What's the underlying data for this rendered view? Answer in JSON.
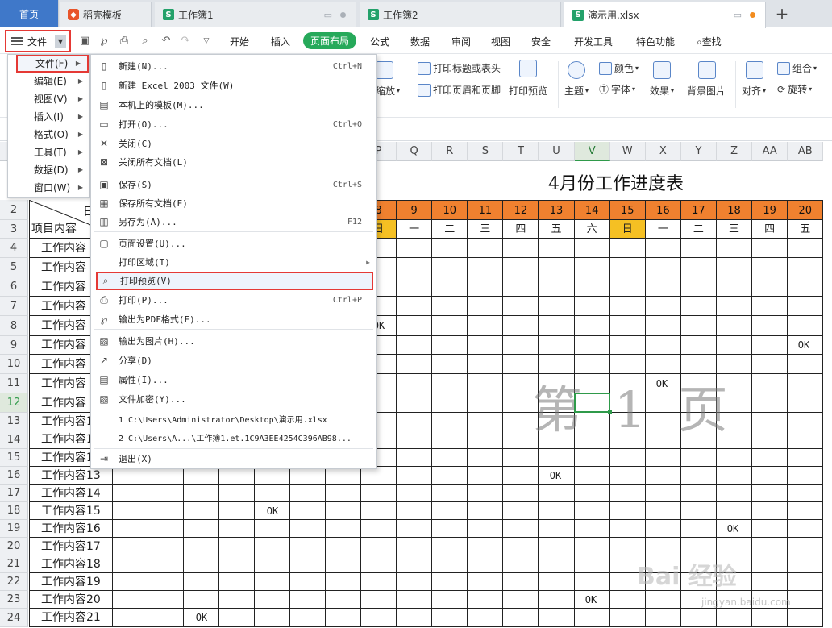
{
  "tabs": {
    "home": "首页",
    "template": "稻壳模板",
    "book1": "工作簿1",
    "book2": "工作簿2",
    "active": "演示用.xlsx",
    "new_tab": "+"
  },
  "menubar": {
    "file": "文件",
    "tabs": [
      "开始",
      "插入",
      "页面布局",
      "公式",
      "数据",
      "审阅",
      "视图",
      "安全",
      "开发工具",
      "特色功能"
    ],
    "active_tab": "页面布局",
    "search": "查找"
  },
  "ribbon": {
    "print_title": "打印标题或表头",
    "print_header_footer": "打印页眉和页脚",
    "print_preview": "打印预览",
    "scale": "缩放",
    "theme": "主题",
    "color": "颜色",
    "font": "字体",
    "effect": "效果",
    "background": "背景图片",
    "align": "对齐",
    "group": "组合",
    "rotate": "旋转"
  },
  "left_menu": {
    "items": [
      {
        "label": "文件(F)"
      },
      {
        "label": "编辑(E)"
      },
      {
        "label": "视图(V)"
      },
      {
        "label": "插入(I)"
      },
      {
        "label": "格式(O)"
      },
      {
        "label": "工具(T)"
      },
      {
        "label": "数据(D)"
      },
      {
        "label": "窗口(W)"
      }
    ],
    "selected": "文件(F)"
  },
  "file_menu": {
    "items": [
      {
        "label": "新建(N)...",
        "shortcut": "Ctrl+N",
        "icon": "new-doc-icon"
      },
      {
        "label": "新建 Excel 2003 文件(W)",
        "shortcut": "",
        "icon": "new-doc-icon"
      },
      {
        "label": "本机上的模板(M)...",
        "shortcut": "",
        "icon": "template-icon"
      },
      {
        "label": "打开(O)...",
        "shortcut": "Ctrl+O",
        "icon": "folder-icon"
      },
      {
        "label": "关闭(C)",
        "shortcut": "",
        "icon": "close-doc-icon"
      },
      {
        "label": "关闭所有文档(L)",
        "shortcut": "",
        "icon": "close-all-icon"
      },
      {
        "label": "保存(S)",
        "shortcut": "Ctrl+S",
        "icon": "save-icon"
      },
      {
        "label": "保存所有文档(E)",
        "shortcut": "",
        "icon": "save-all-icon"
      },
      {
        "label": "另存为(A)...",
        "shortcut": "F12",
        "icon": "save-as-icon"
      },
      {
        "label": "页面设置(U)...",
        "shortcut": "",
        "icon": "page-setup-icon"
      },
      {
        "label": "打印区域(T)",
        "shortcut": "",
        "icon": "print-area-icon"
      },
      {
        "label": "打印预览(V)",
        "shortcut": "",
        "icon": "print-preview-icon"
      },
      {
        "label": "打印(P)...",
        "shortcut": "Ctrl+P",
        "icon": "printer-icon"
      },
      {
        "label": "输出为PDF格式(F)...",
        "shortcut": "",
        "icon": "pdf-icon"
      },
      {
        "label": "输出为图片(H)...",
        "shortcut": "",
        "icon": "image-icon"
      },
      {
        "label": "分享(D)",
        "shortcut": "",
        "icon": "share-icon"
      },
      {
        "label": "属性(I)...",
        "shortcut": "",
        "icon": "properties-icon"
      },
      {
        "label": "文件加密(Y)...",
        "shortcut": "",
        "icon": "encrypt-icon"
      }
    ],
    "recent": [
      "1 C:\\Users\\Administrator\\Desktop\\演示用.xlsx",
      "2 C:\\Users\\A...\\工作簿1.et.1C9A3EE4254C396AB98..."
    ],
    "exit": "退出(X)",
    "highlighted": "打印预览(V)"
  },
  "sheet": {
    "columns": [
      "P",
      "Q",
      "R",
      "S",
      "T",
      "U",
      "V",
      "W",
      "X",
      "Y",
      "Z",
      "AA",
      "AB"
    ],
    "selected_column": "V",
    "rows": [
      "2",
      "3",
      "4",
      "5",
      "6",
      "7",
      "8",
      "9",
      "10",
      "11",
      "12",
      "13",
      "14",
      "15",
      "16",
      "17",
      "18",
      "19",
      "20",
      "21",
      "22",
      "23",
      "24"
    ],
    "selected_row": "12",
    "title": "4月份工作进度表",
    "header_row_label": "日",
    "header_item_label": "项目内容",
    "dates": [
      "8",
      "9",
      "10",
      "11",
      "12",
      "13",
      "14",
      "15",
      "16",
      "17",
      "18",
      "19",
      "20"
    ],
    "weekdays": [
      "日",
      "一",
      "二",
      "三",
      "四",
      "五",
      "六",
      "日",
      "一",
      "二",
      "三",
      "四",
      "五"
    ],
    "items": [
      "工作内容",
      "工作内容",
      "工作内容",
      "工作内容",
      "工作内容",
      "工作内容",
      "工作内容",
      "工作内容",
      "工作内容",
      "工作内容13",
      "工作内容14",
      "工作内容15",
      "工作内容13",
      "工作内容14",
      "工作内容15",
      "工作内容16",
      "工作内容17",
      "工作内容18",
      "工作内容19",
      "工作内容20",
      "工作内容21"
    ],
    "ok_text": "OK",
    "watermark": "第 1 页",
    "colors": {
      "date_bg": "#f0812f",
      "sunday_bg": "#f5c023",
      "highlight_border": "#e53935",
      "accent_green": "#26a95a"
    }
  },
  "watermark": {
    "brand": "Bai 经验",
    "url": "jingyan.baidu.com"
  }
}
